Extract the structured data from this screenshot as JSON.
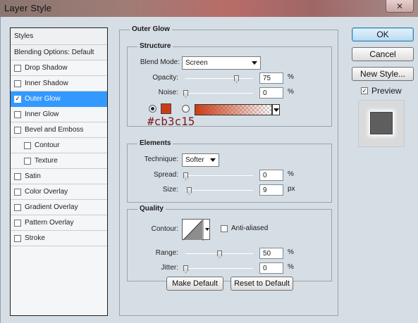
{
  "window": {
    "title": "Layer Style",
    "close_glyph": "✕"
  },
  "styles_list": {
    "header": "Styles",
    "blending_options": "Blending Options: Default",
    "items": [
      {
        "label": "Drop Shadow",
        "checked": false
      },
      {
        "label": "Inner Shadow",
        "checked": false
      },
      {
        "label": "Outer Glow",
        "checked": true
      },
      {
        "label": "Inner Glow",
        "checked": false
      },
      {
        "label": "Bevel and Emboss",
        "checked": false
      },
      {
        "label": "Contour",
        "checked": false
      },
      {
        "label": "Texture",
        "checked": false
      },
      {
        "label": "Satin",
        "checked": false
      },
      {
        "label": "Color Overlay",
        "checked": false
      },
      {
        "label": "Gradient Overlay",
        "checked": false
      },
      {
        "label": "Pattern Overlay",
        "checked": false
      },
      {
        "label": "Stroke",
        "checked": false
      }
    ],
    "check_glyph": "✓"
  },
  "outer_glow": {
    "title": "Outer Glow",
    "structure": {
      "title": "Structure",
      "blend_mode_label": "Blend Mode:",
      "blend_mode_value": "Screen",
      "opacity_label": "Opacity:",
      "opacity_value": "75",
      "opacity_unit": "%",
      "opacity_fraction": 0.75,
      "noise_label": "Noise:",
      "noise_value": "0",
      "noise_unit": "%",
      "glow_color": "#cb3c15",
      "color_annotation": "#cb3c15"
    },
    "elements": {
      "title": "Elements",
      "technique_label": "Technique:",
      "technique_value": "Softer",
      "spread_label": "Spread:",
      "spread_value": "0",
      "spread_unit": "%",
      "size_label": "Size:",
      "size_value": "9",
      "size_unit": "px"
    },
    "quality": {
      "title": "Quality",
      "contour_label": "Contour:",
      "anti_aliased_label": "Anti-aliased",
      "range_label": "Range:",
      "range_value": "50",
      "range_unit": "%",
      "jitter_label": "Jitter:",
      "jitter_value": "0",
      "jitter_unit": "%"
    },
    "make_default_label": "Make Default",
    "reset_default_label": "Reset to Default"
  },
  "buttons": {
    "ok": "OK",
    "cancel": "Cancel",
    "new_style": "New Style...",
    "preview_label": "Preview",
    "preview_checked": true
  }
}
